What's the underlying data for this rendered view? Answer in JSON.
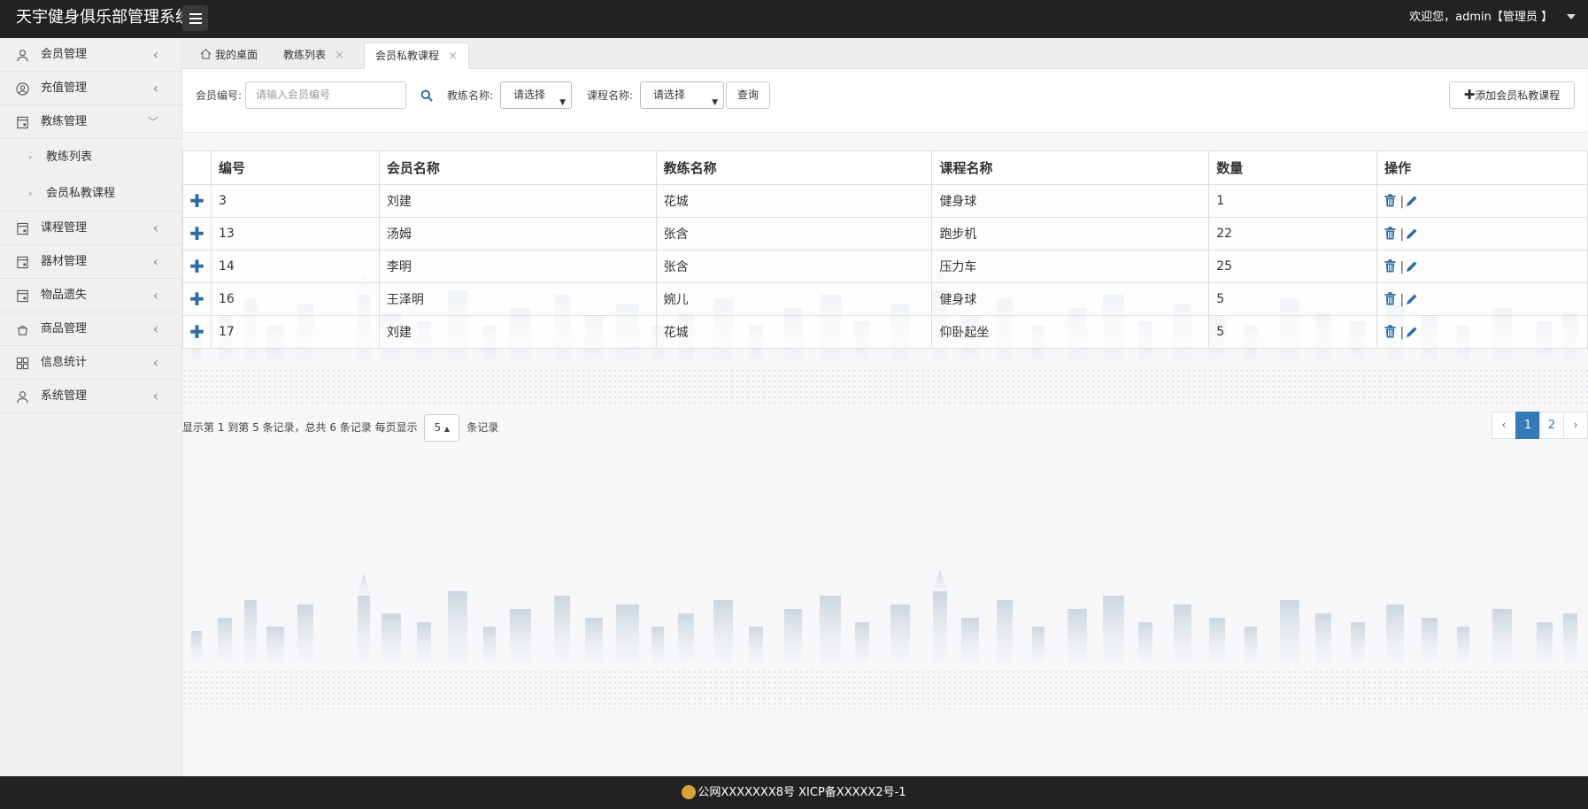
{
  "app": {
    "title": "天宇健身俱乐部管理系统"
  },
  "user": {
    "greeting": "欢迎您，admin【管理员 】"
  },
  "sidebar": {
    "items": [
      {
        "label": "会员管理",
        "icon": "user-icon"
      },
      {
        "label": "充值管理",
        "icon": "user-circle-icon"
      },
      {
        "label": "教练管理",
        "icon": "book-icon",
        "expanded": true,
        "children": [
          {
            "label": "教练列表"
          },
          {
            "label": "会员私教课程"
          }
        ]
      },
      {
        "label": "课程管理",
        "icon": "book-icon"
      },
      {
        "label": "器材管理",
        "icon": "book-icon"
      },
      {
        "label": "物品遗失",
        "icon": "book-icon"
      },
      {
        "label": "商品管理",
        "icon": "bag-icon"
      },
      {
        "label": "信息统计",
        "icon": "grid-icon"
      },
      {
        "label": "系统管理",
        "icon": "user-icon"
      }
    ]
  },
  "tabs": [
    {
      "label": "我的桌面",
      "icon": "home-icon"
    },
    {
      "label": "教练列表"
    },
    {
      "label": "会员私教课程",
      "active": true
    }
  ],
  "search": {
    "member_no_label": "会员编号:",
    "member_no_placeholder": "请输入会员编号",
    "coach_label": "教练名称:",
    "coach_value": "请选择",
    "course_label": "课程名称:",
    "course_value": "请选择",
    "query_label": "查询",
    "add_label": "添加会员私教课程"
  },
  "table": {
    "headers": [
      "编号",
      "会员名称",
      "教练名称",
      "课程名称",
      "数量",
      "操作"
    ],
    "rows": [
      {
        "id": "3",
        "member": "刘建",
        "coach": "花城",
        "course": "健身球",
        "qty": "1"
      },
      {
        "id": "13",
        "member": "汤姆",
        "coach": "张含",
        "course": "跑步机",
        "qty": "22"
      },
      {
        "id": "14",
        "member": "李明",
        "coach": "张含",
        "course": "压力车",
        "qty": "25"
      },
      {
        "id": "16",
        "member": "王泽明",
        "coach": "婉儿",
        "course": "健身球",
        "qty": "5"
      },
      {
        "id": "17",
        "member": "刘建",
        "coach": "花城",
        "course": "仰卧起坐",
        "qty": "5"
      }
    ],
    "op_separator": "|"
  },
  "pagination": {
    "info_prefix": "显示第 1 到第 5 条记录，总共 6 条记录 每页显示",
    "page_size": "5",
    "info_suffix": "条记录",
    "prev": "‹",
    "pages": [
      "1",
      "2"
    ],
    "current": "1",
    "next": "›"
  },
  "footer": {
    "text": "公网XXXXXXX8号 XICP备XXXXX2号-1"
  },
  "colors": {
    "accent": "#337ab7",
    "header_bg": "#222222",
    "icon_blue": "#2e6da4"
  }
}
